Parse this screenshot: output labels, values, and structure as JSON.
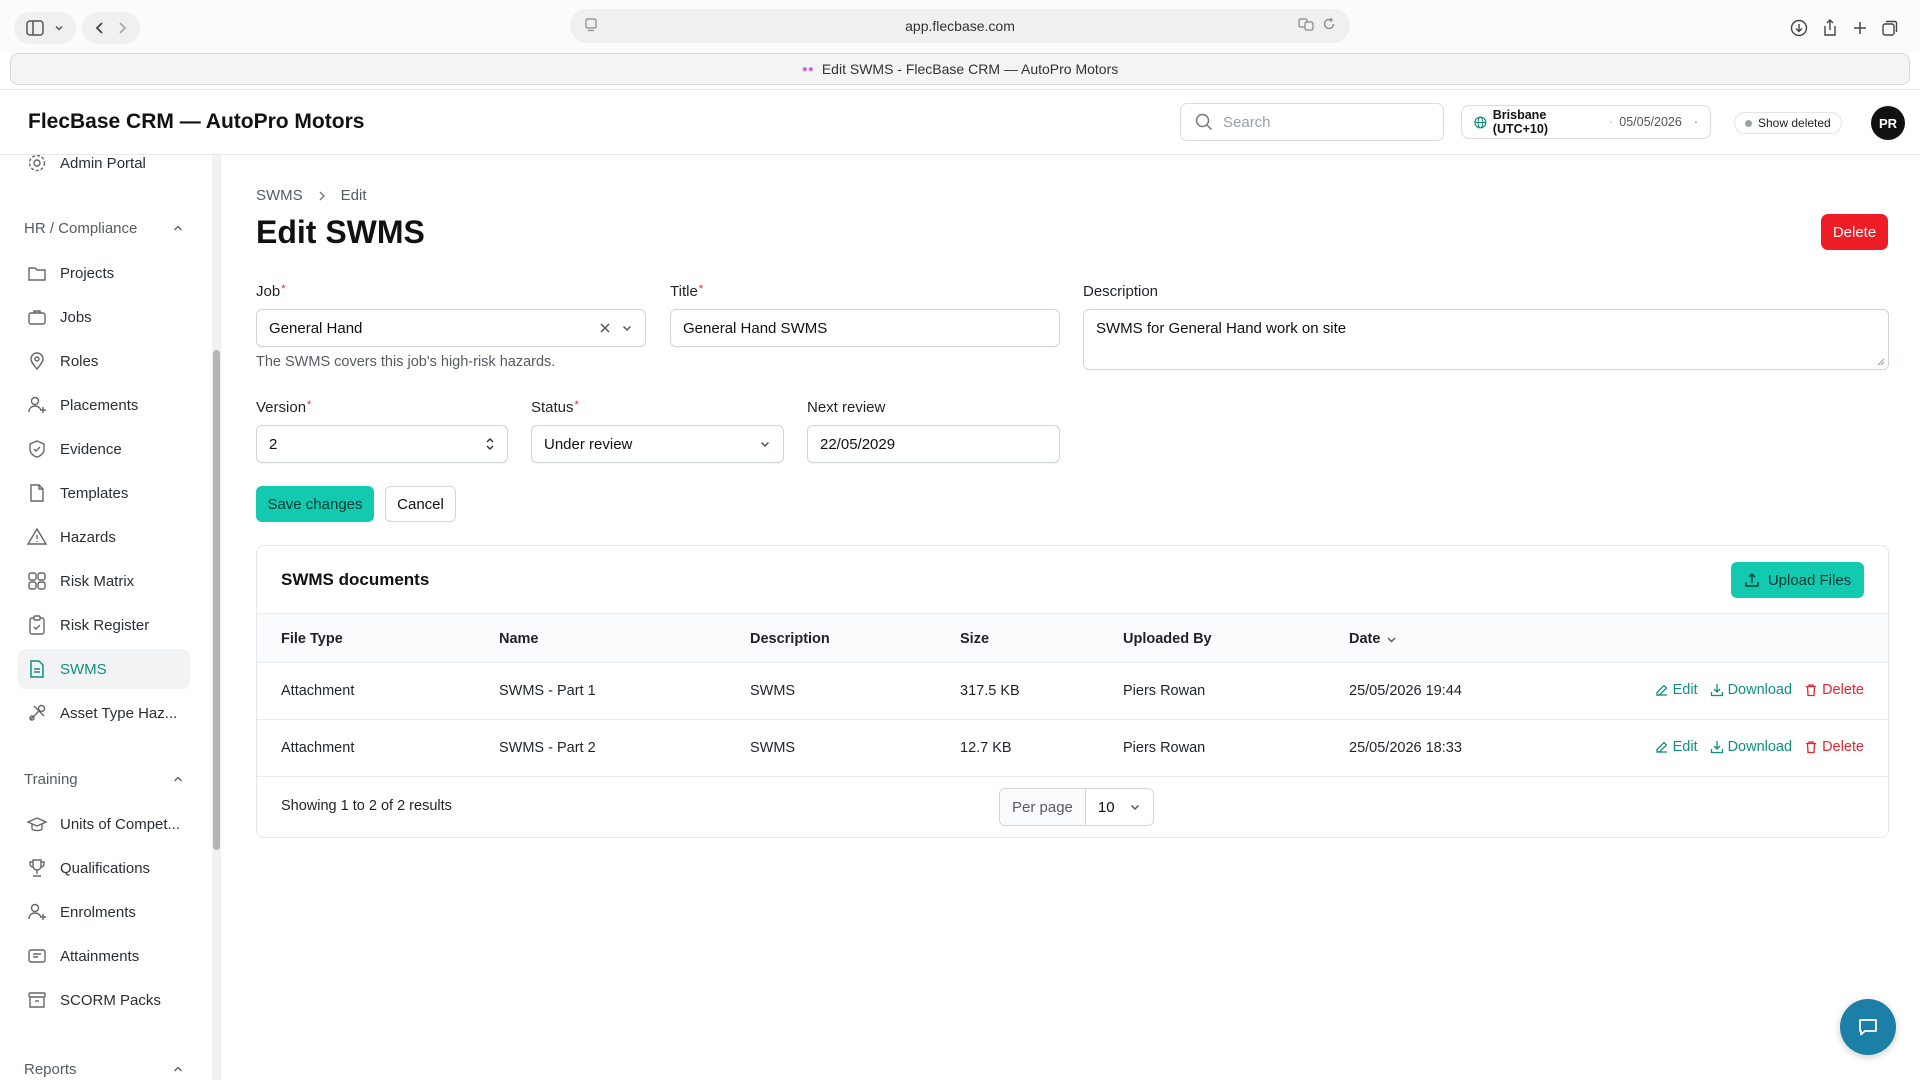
{
  "browser": {
    "url": "app.flecbase.com",
    "tab_title": "Edit SWMS - FlecBase CRM — AutoPro Motors"
  },
  "header": {
    "app_title": "FlecBase CRM — AutoPro Motors",
    "search_placeholder": "Search",
    "timezone": "Brisbane (UTC+10)",
    "date": "05/05/2026",
    "show_deleted": "Show deleted",
    "avatar_initials": "PR"
  },
  "sidebar": {
    "top_item": "Admin Portal",
    "sections": [
      {
        "title": "HR / Compliance",
        "items": [
          "Projects",
          "Jobs",
          "Roles",
          "Placements",
          "Evidence",
          "Templates",
          "Hazards",
          "Risk Matrix",
          "Risk Register",
          "SWMS",
          "Asset Type Haz..."
        ]
      },
      {
        "title": "Training",
        "items": [
          "Units of Compet...",
          "Qualifications",
          "Enrolments",
          "Attainments",
          "SCORM Packs"
        ]
      },
      {
        "title": "Reports",
        "items": []
      }
    ],
    "active_item": "SWMS"
  },
  "page": {
    "breadcrumb": [
      "SWMS",
      "Edit"
    ],
    "title": "Edit SWMS",
    "delete_label": "Delete"
  },
  "form": {
    "job_label": "Job",
    "job_value": "General Hand",
    "job_helper": "The SWMS covers this job's high-risk hazards.",
    "title_label": "Title",
    "title_value": "General Hand SWMS",
    "description_label": "Description",
    "description_value": "SWMS for General Hand work on site",
    "version_label": "Version",
    "version_value": "2",
    "status_label": "Status",
    "status_value": "Under review",
    "next_review_label": "Next review",
    "next_review_value": "22/05/2029",
    "save_label": "Save changes",
    "cancel_label": "Cancel"
  },
  "documents": {
    "title": "SWMS documents",
    "upload_label": "Upload Files",
    "columns": [
      "File Type",
      "Name",
      "Description",
      "Size",
      "Uploaded By",
      "Date"
    ],
    "rows": [
      {
        "file_type": "Attachment",
        "name": "SWMS - Part 1",
        "description": "SWMS",
        "size": "317.5 KB",
        "uploaded_by": "Piers Rowan",
        "date": "25/05/2026 19:44"
      },
      {
        "file_type": "Attachment",
        "name": "SWMS - Part 2",
        "description": "SWMS",
        "size": "12.7 KB",
        "uploaded_by": "Piers Rowan",
        "date": "25/05/2026 18:33"
      }
    ],
    "actions": {
      "edit": "Edit",
      "download": "Download",
      "delete": "Delete"
    },
    "footer_text": "Showing 1 to 2 of 2 results",
    "per_page_label": "Per page",
    "per_page_value": "10"
  },
  "colors": {
    "accent": "#13c9b0",
    "link": "#0f8f7e",
    "danger": "#ee1c25",
    "chat": "#1b7fa8"
  }
}
